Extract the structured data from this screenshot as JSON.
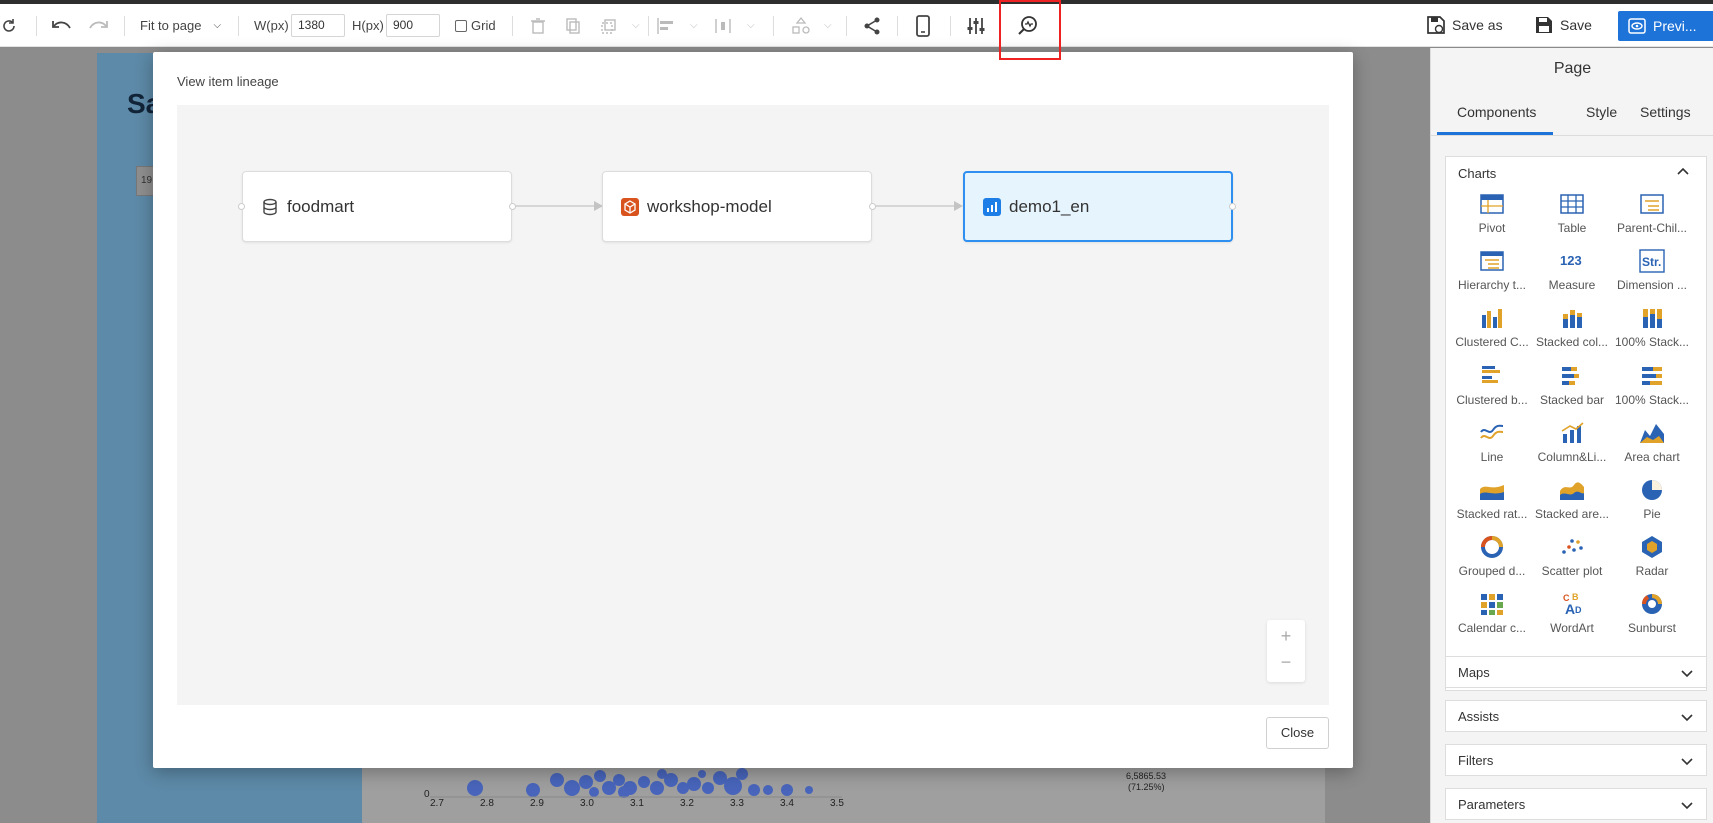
{
  "toolbar": {
    "fit": "Fit to page",
    "w_label": "W(px)",
    "w_value": "1380",
    "h_label": "H(px)",
    "h_value": "900",
    "grid_label": "Grid",
    "save_as": "Save as",
    "save": "Save",
    "preview": "Previ..."
  },
  "background": {
    "title_fragment": "Sa",
    "small_box": "19",
    "axis_ticks": [
      "2.7",
      "2.8",
      "2.9",
      "3.0",
      "3.1",
      "3.2",
      "3.3",
      "3.4",
      "3.5"
    ],
    "y_zero": "0",
    "annotation_value": "6,5865.53",
    "annotation_pct": "(71.25%)"
  },
  "modal": {
    "title": "View item lineage",
    "nodes": [
      {
        "label": "foodmart",
        "icon": "database-icon"
      },
      {
        "label": "workshop-model",
        "icon": "model-cube-icon"
      },
      {
        "label": "demo1_en",
        "icon": "report-chart-icon"
      }
    ],
    "zoom_in": "+",
    "zoom_out": "−",
    "close": "Close"
  },
  "sidebar": {
    "title": "Page",
    "tabs": [
      "Components",
      "Style",
      "Settings"
    ],
    "charts_header": "Charts",
    "chart_items": [
      "Pivot",
      "Table",
      "Parent-Chil...",
      "Hierarchy t...",
      "Measure",
      "Dimension ...",
      "Clustered C...",
      "Stacked col...",
      "100% Stack...",
      "Clustered b...",
      "Stacked bar",
      "100% Stack...",
      "Line",
      "Column&Li...",
      "Area chart",
      "Stacked rat...",
      "Stacked are...",
      "Pie",
      "Grouped d...",
      "Scatter plot",
      "Radar",
      "Calendar c...",
      "WordArt",
      "Sunburst"
    ],
    "sections": [
      "Maps",
      "Assists",
      "Filters",
      "Parameters"
    ]
  },
  "colors": {
    "accent": "#1e73d8",
    "highlight": "#e22222",
    "node_selected_bg": "#e6f4fd",
    "node_selected_border": "#2e8ff0"
  }
}
